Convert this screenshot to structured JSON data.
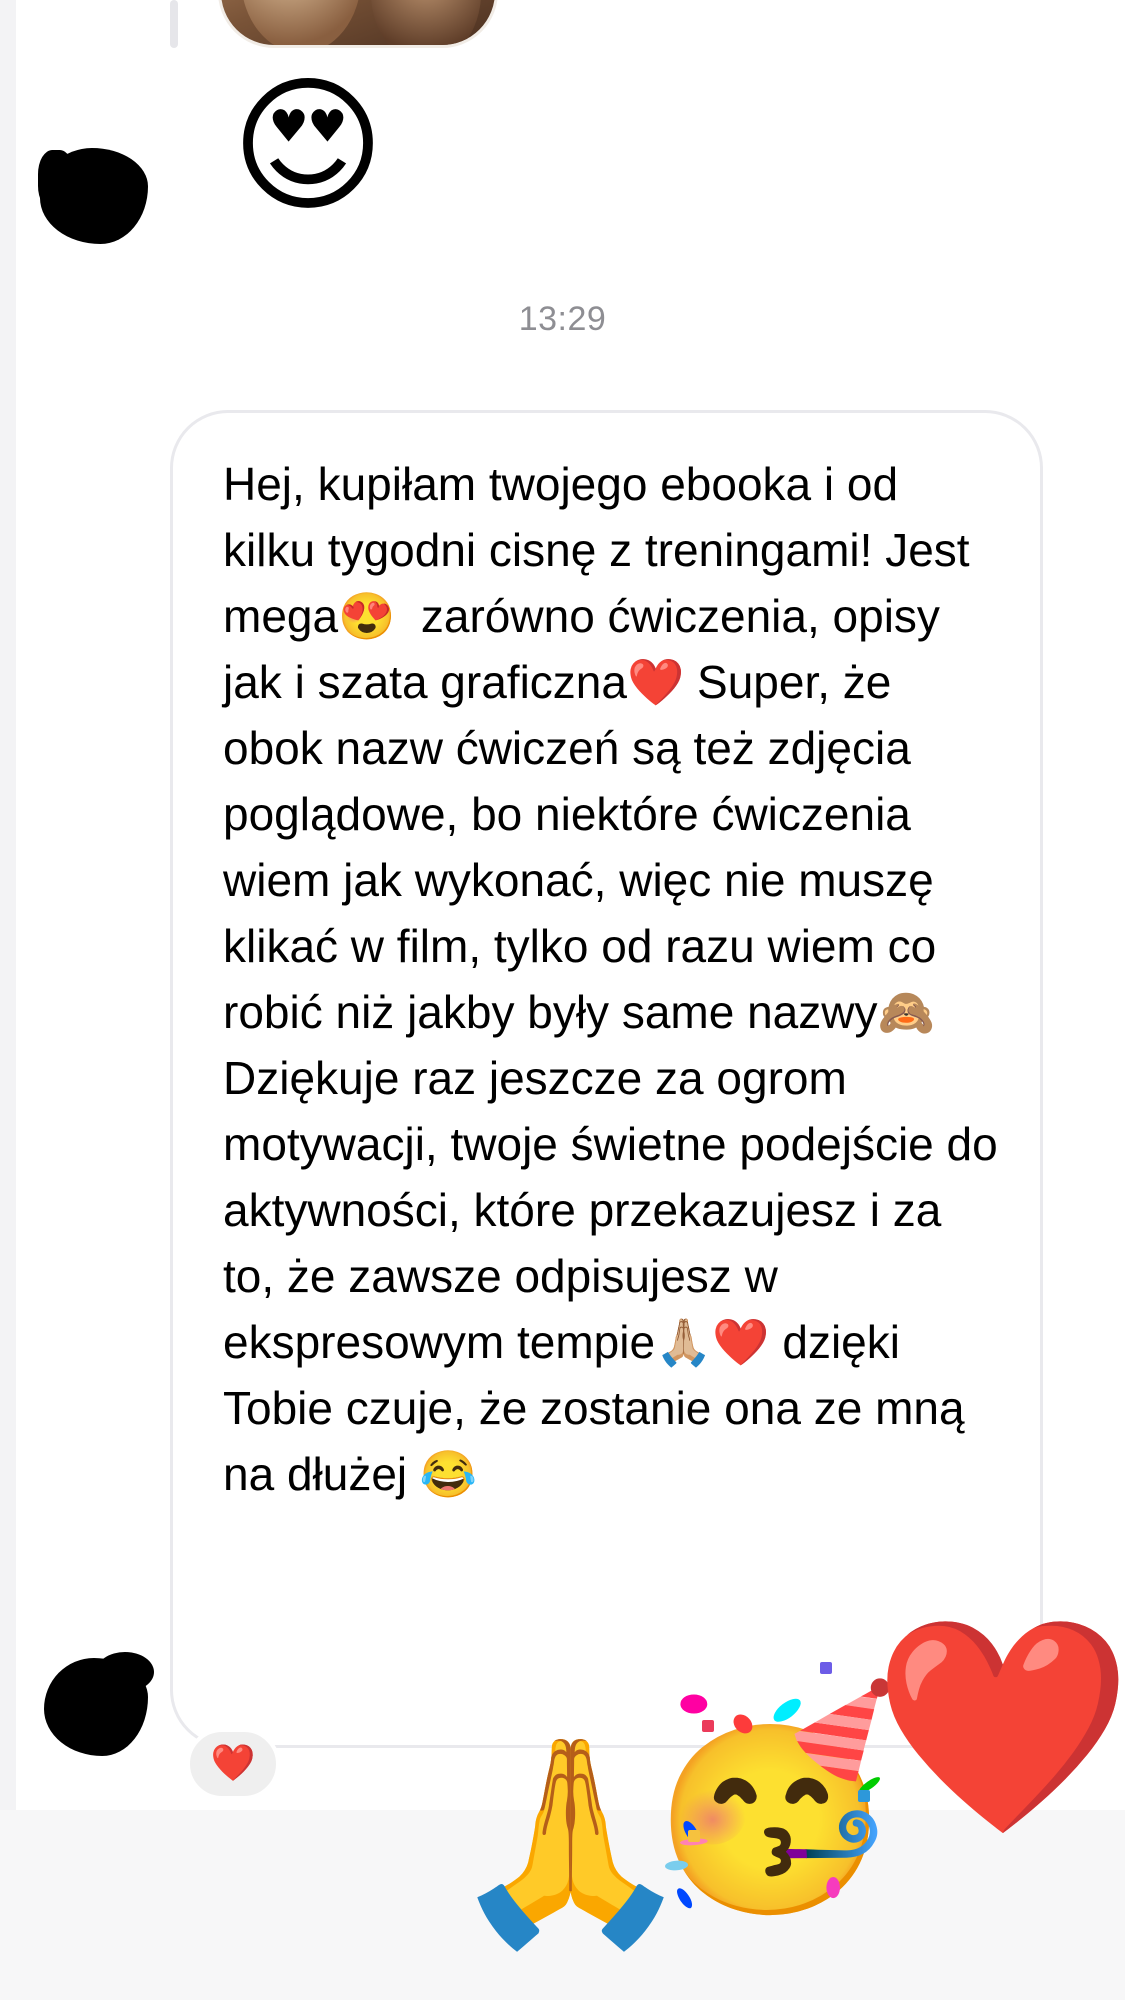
{
  "thread": {
    "photo_message": "photo",
    "emoji_message": "😍",
    "timestamp": "13:29"
  },
  "message": {
    "text": "Hej, kupiłam twojego ebooka i od kilku tygodni cisnę z treningami! Jest mega😍  zarówno ćwiczenia, opisy jak i szata graficzna❤️ Super, że obok nazw ćwiczeń są też zdjęcia poglądowe, bo niektóre ćwiczenia wiem jak wykonać, więc nie muszę klikać w film, tylko od razu wiem co robić niż jakby były same nazwy🙈 Dziękuje raz jeszcze za ogrom motywacji, twoje świetne podejście do aktywności, które przekazujesz i za to, że zawsze odpisujesz w ekspresowym tempie🙏🏼❤️ dzięki Tobie czuje, że zostanie ona ze mną na dłużej 😂",
    "reaction": "❤️"
  },
  "floating_reactions": [
    {
      "name": "praying-hands-icon",
      "glyph": "🙏"
    },
    {
      "name": "partying-face-icon",
      "glyph": "🥳"
    },
    {
      "name": "red-heart-icon",
      "glyph": "❤️"
    }
  ],
  "colors": {
    "timestamp": "#8e8e93",
    "bubble_border": "#e9e9ed",
    "reaction_bg": "#efefef",
    "heart": "#ee1c2b",
    "text": "#000000"
  }
}
